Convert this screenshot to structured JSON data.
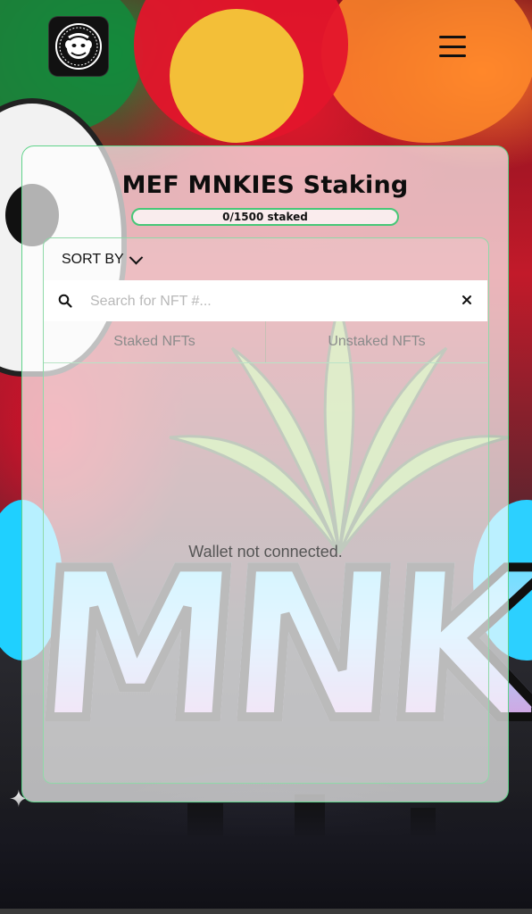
{
  "header": {
    "logo_alt": "MEF MNKIES logo",
    "logo_icon": "monkey-logo-icon",
    "menu_icon": "hamburger-menu-icon"
  },
  "staking": {
    "title": "MEF MNKIES Staking",
    "progress_label": "0/1500 staked",
    "staked_count": 0,
    "total_supply": 1500,
    "progress_fraction": 0
  },
  "controls": {
    "sort_label": "SORT BY",
    "search_placeholder": "Search for NFT #...",
    "search_value": "",
    "search_icon": "search-icon",
    "clear_icon": "close-icon"
  },
  "tabs": [
    {
      "label": "Staked NFTs"
    },
    {
      "label": "Unstaked NFTs"
    }
  ],
  "list": {
    "empty_message": "Wallet not connected."
  },
  "colors": {
    "accent": "#46c777",
    "card_border": "#5fd38a"
  }
}
